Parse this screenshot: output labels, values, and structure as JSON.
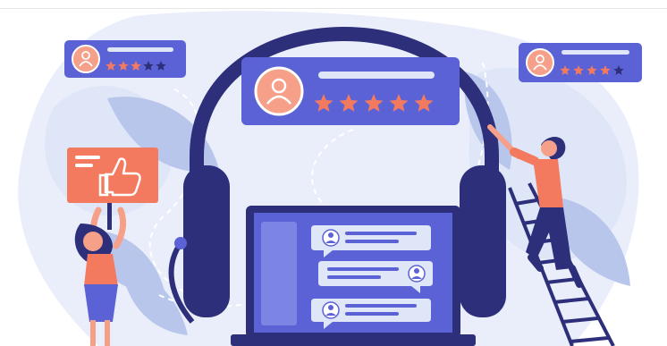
{
  "illustration": {
    "subject": "customer-support-feedback",
    "colors": {
      "navy": "#2d2f7a",
      "indigo": "#3f41a0",
      "periwinkle": "#5b62d6",
      "light_blue": "#dfe6f7",
      "pale_blue": "#eef2fb",
      "coral": "#f47a5f",
      "coral_light": "#f7a089",
      "leaf_blue": "#b9c6ec",
      "white": "#ffffff"
    },
    "rating_cards": [
      {
        "position": "top-left",
        "filled_stars": 3,
        "total_stars": 5
      },
      {
        "position": "top-center",
        "filled_stars": 5,
        "total_stars": 5
      },
      {
        "position": "top-right",
        "filled_stars": 4,
        "total_stars": 5
      }
    ],
    "icons": [
      "thumbs-up-icon",
      "user-avatar-icon",
      "star-icon",
      "chat-bubble-icon",
      "headphones-icon",
      "laptop-icon",
      "ladder-icon"
    ]
  }
}
